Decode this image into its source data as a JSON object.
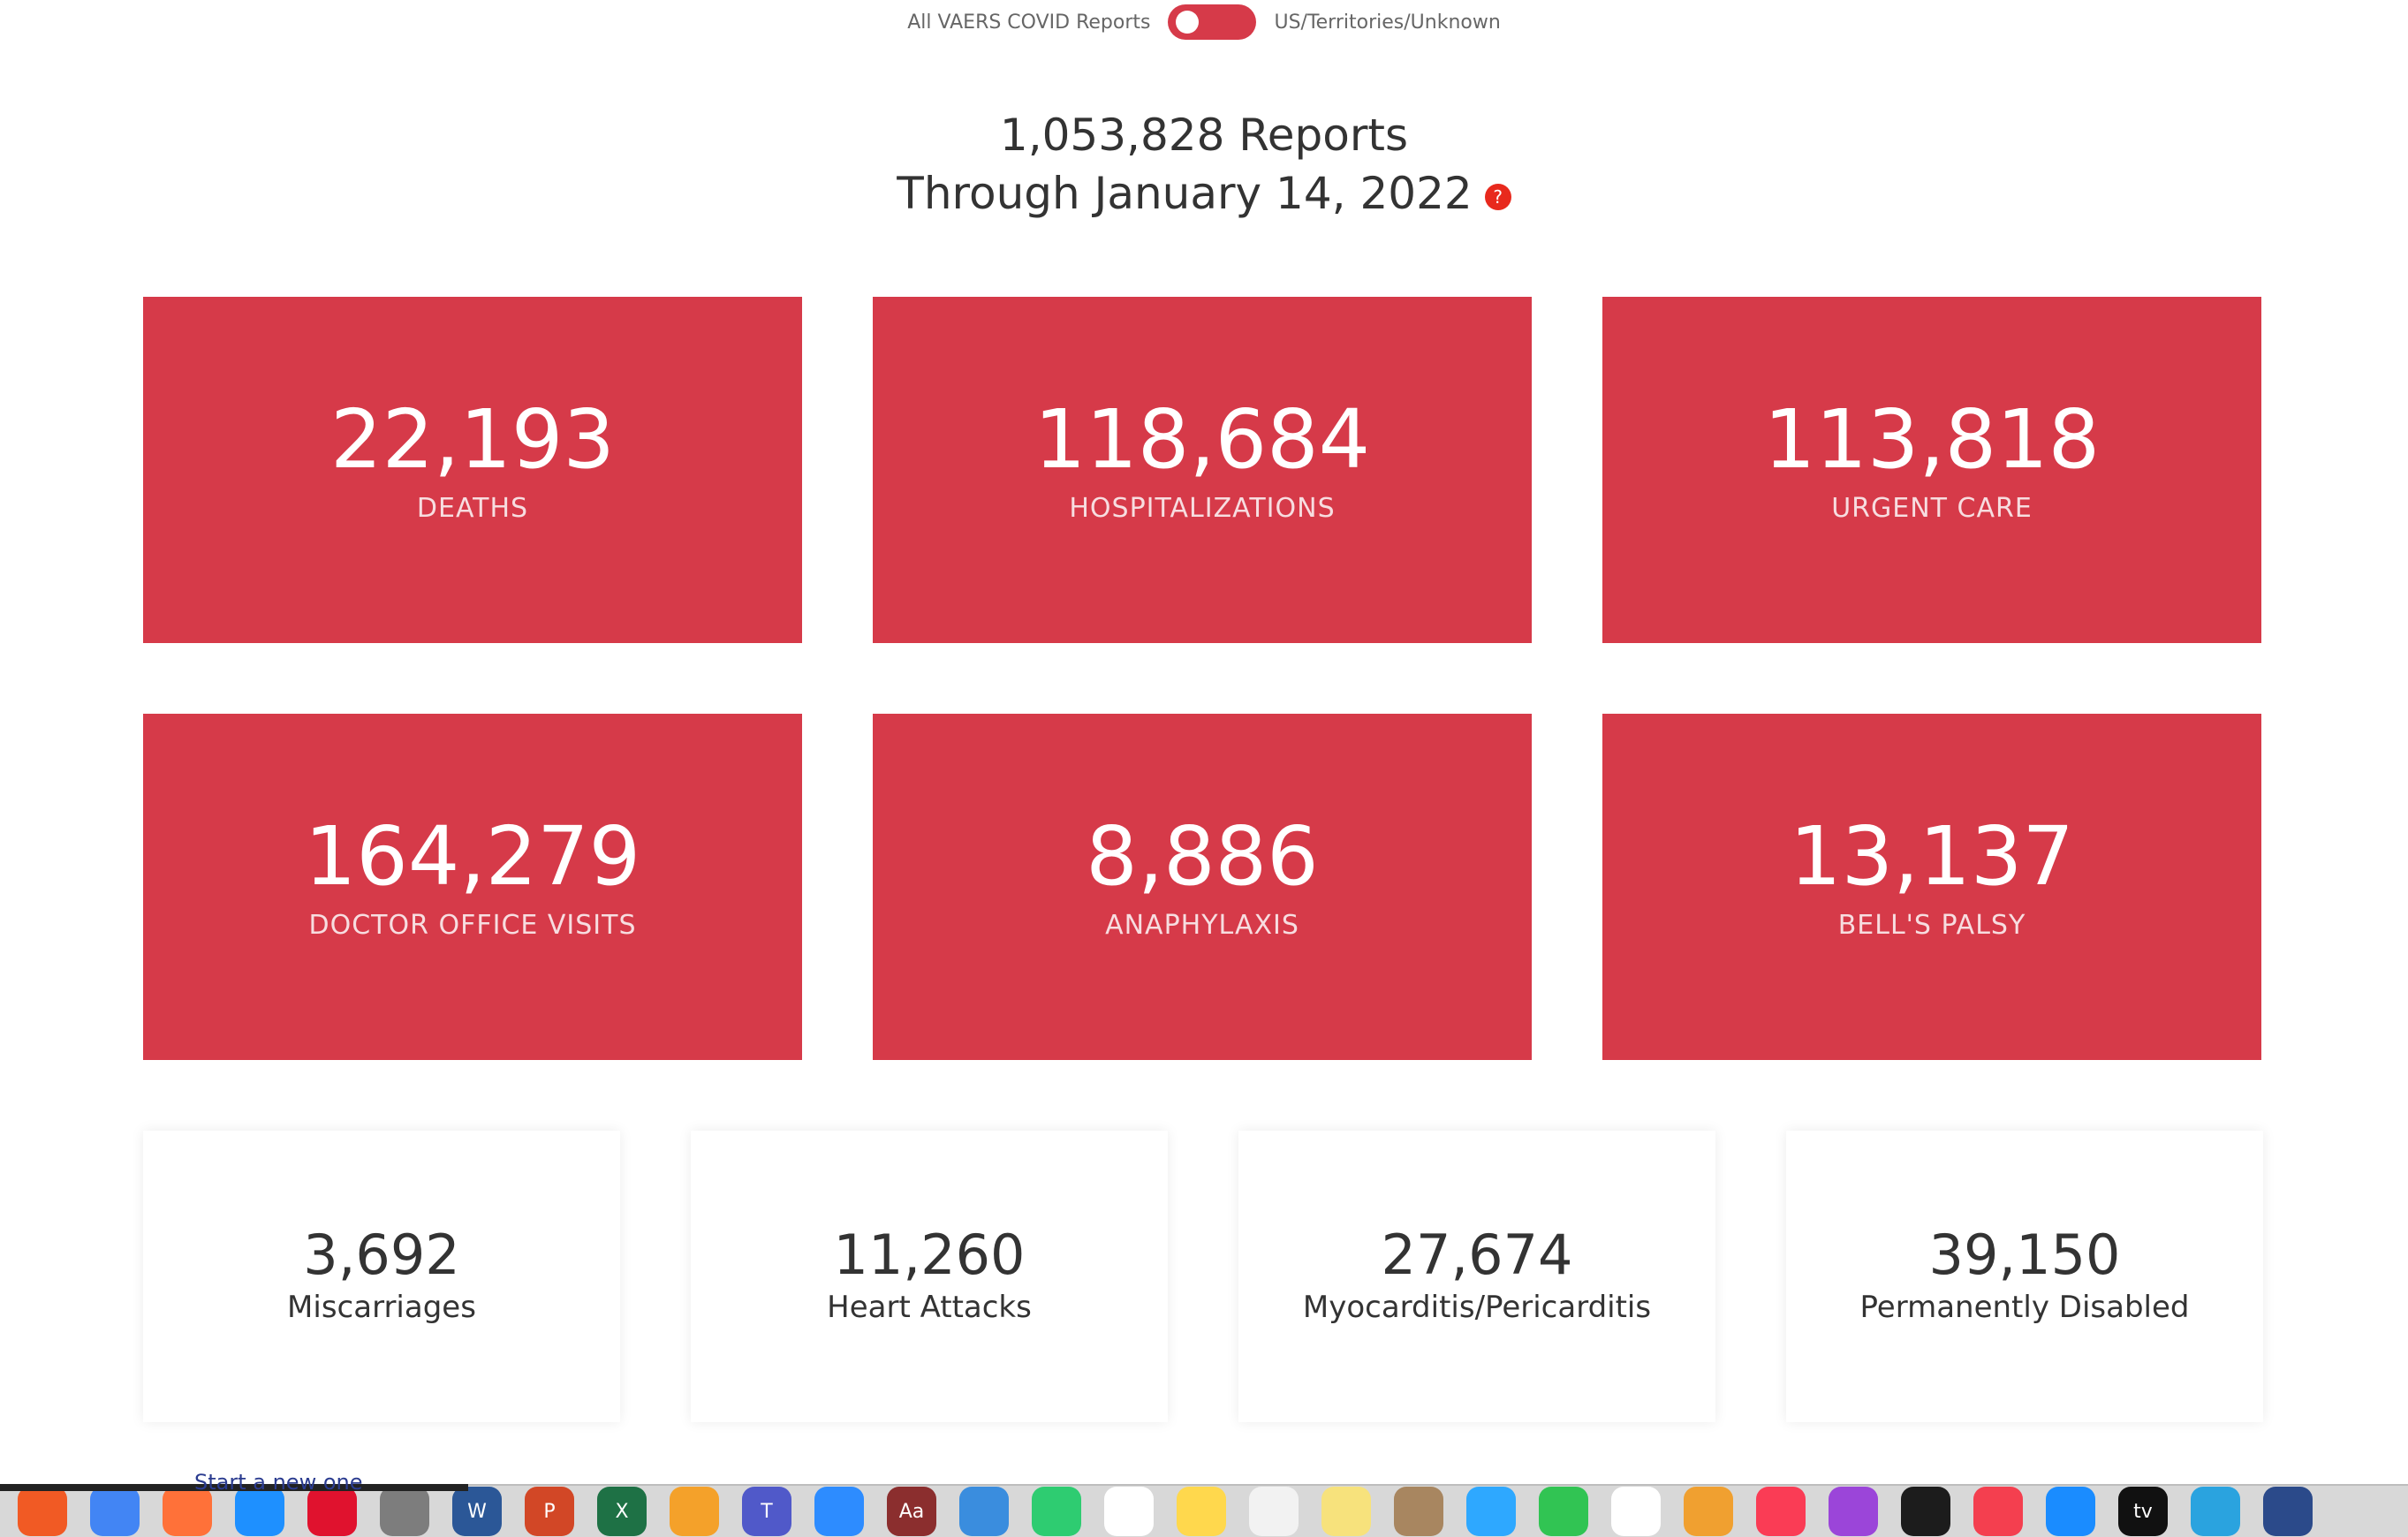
{
  "toggle": {
    "left_label": "All VAERS COVID Reports",
    "right_label": "US/Territories/Unknown"
  },
  "header": {
    "reports_line": "1,053,828 Reports",
    "through_line": "Through January 14, 2022",
    "help_glyph": "?"
  },
  "red_stats": [
    {
      "value": "22,193",
      "label": "DEATHS"
    },
    {
      "value": "118,684",
      "label": "HOSPITALIZATIONS"
    },
    {
      "value": "113,818",
      "label": "URGENT CARE"
    },
    {
      "value": "164,279",
      "label": "DOCTOR OFFICE VISITS"
    },
    {
      "value": "8,886",
      "label": "ANAPHYLAXIS"
    },
    {
      "value": "13,137",
      "label": "BELL'S PALSY"
    }
  ],
  "white_stats": [
    {
      "value": "3,692",
      "label": "Miscarriages"
    },
    {
      "value": "11,260",
      "label": "Heart Attacks"
    },
    {
      "value": "27,674",
      "label": "Myocarditis/Pericarditis"
    },
    {
      "value": "39,150",
      "label": "Permanently Disabled"
    }
  ],
  "colors": {
    "accent_red": "#d63a49",
    "help_red": "#e8291d",
    "text_dark": "#333333"
  },
  "dock": {
    "partial_text": "Start a new one",
    "apps": [
      {
        "icon": "brave-icon",
        "color": "#f15a24",
        "glyph": ""
      },
      {
        "icon": "chrome-icon",
        "color": "#4285f4",
        "glyph": ""
      },
      {
        "icon": "firefox-icon",
        "color": "#ff7139",
        "glyph": ""
      },
      {
        "icon": "safari-icon",
        "color": "#1e90ff",
        "glyph": ""
      },
      {
        "icon": "opera-icon",
        "color": "#e0122e",
        "glyph": ""
      },
      {
        "icon": "system-preferences-icon",
        "color": "#7d7d7d",
        "glyph": ""
      },
      {
        "icon": "word-icon",
        "color": "#2b5797",
        "glyph": "W"
      },
      {
        "icon": "powerpoint-icon",
        "color": "#d24726",
        "glyph": "P"
      },
      {
        "icon": "excel-icon",
        "color": "#1e7145",
        "glyph": "X"
      },
      {
        "icon": "pages-icon",
        "color": "#f4a12a",
        "glyph": ""
      },
      {
        "icon": "teams-icon",
        "color": "#5059c9",
        "glyph": "T"
      },
      {
        "icon": "zoom-icon",
        "color": "#2d8cff",
        "glyph": ""
      },
      {
        "icon": "dictionary-icon",
        "color": "#8b2e2e",
        "glyph": "Aa"
      },
      {
        "icon": "keynote-icon",
        "color": "#3a8dde",
        "glyph": ""
      },
      {
        "icon": "numbers-icon",
        "color": "#2ecc71",
        "glyph": ""
      },
      {
        "icon": "reminders-icon",
        "color": "#ffffff",
        "glyph": ""
      },
      {
        "icon": "notes-icon",
        "color": "#ffd84d",
        "glyph": ""
      },
      {
        "icon": "textedit-icon",
        "color": "#f2f2f2",
        "glyph": ""
      },
      {
        "icon": "stickies-icon",
        "color": "#f7e27c",
        "glyph": ""
      },
      {
        "icon": "contacts-icon",
        "color": "#a88660",
        "glyph": ""
      },
      {
        "icon": "messages-icon",
        "color": "#2ea8ff",
        "glyph": ""
      },
      {
        "icon": "facetime-icon",
        "color": "#31c453",
        "glyph": ""
      },
      {
        "icon": "calendar-icon",
        "color": "#ffffff",
        "glyph": ""
      },
      {
        "icon": "photos-icon",
        "color": "#f0a030",
        "glyph": ""
      },
      {
        "icon": "music-icon",
        "color": "#fa3c55",
        "glyph": ""
      },
      {
        "icon": "podcasts-icon",
        "color": "#9b45d9",
        "glyph": ""
      },
      {
        "icon": "stocks-icon",
        "color": "#1c1c1c",
        "glyph": ""
      },
      {
        "icon": "news-icon",
        "color": "#f43f4f",
        "glyph": ""
      },
      {
        "icon": "app-store-icon",
        "color": "#1a8cff",
        "glyph": ""
      },
      {
        "icon": "apple-tv-icon",
        "color": "#111111",
        "glyph": "tv"
      },
      {
        "icon": "telegram-icon",
        "color": "#2aa3df",
        "glyph": ""
      },
      {
        "icon": "quicktime-icon",
        "color": "#2b4a8a",
        "glyph": ""
      }
    ]
  }
}
